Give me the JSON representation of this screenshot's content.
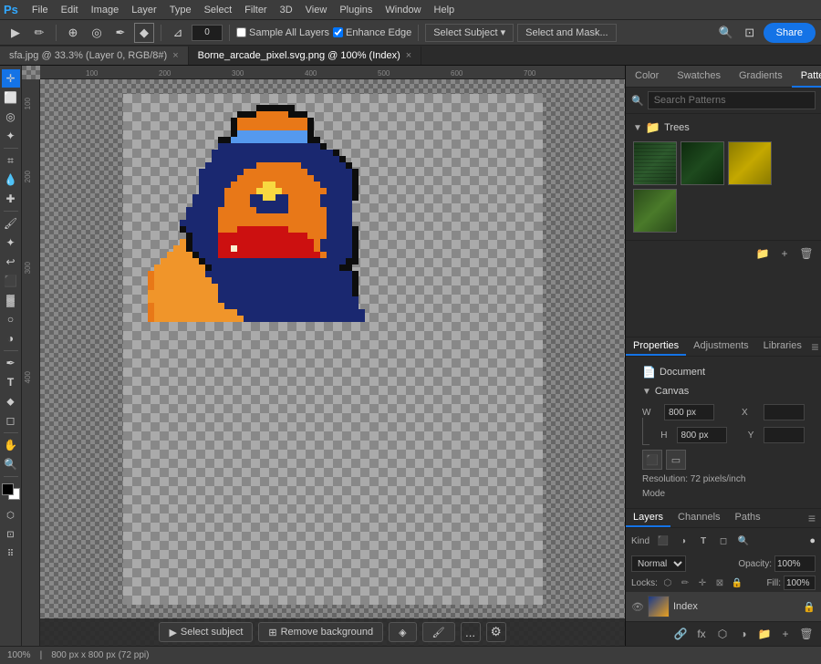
{
  "app": {
    "title": "Adobe Photoshop"
  },
  "menu": {
    "logo": "Ps",
    "items": [
      "File",
      "Edit",
      "Image",
      "Layer",
      "Type",
      "Select",
      "Filter",
      "3D",
      "View",
      "Plugins",
      "Window",
      "Help"
    ]
  },
  "toolbar": {
    "angle_value": "0",
    "sample_all_layers_label": "Sample All Layers",
    "enhance_edge_label": "Enhance Edge",
    "select_subject_label": "Select Subject",
    "select_mask_label": "Select and Mask...",
    "share_label": "Share"
  },
  "tabs": [
    {
      "label": "sfa.jpg @ 33.3% (Layer 0, RGB/8#)",
      "active": false
    },
    {
      "label": "Borne_arcade_pixel.svg.png @ 100% (Index)",
      "active": true
    }
  ],
  "canvas": {
    "zoom": "100%",
    "size": "800 px x 800 px (72 ppi)"
  },
  "patterns_panel": {
    "search_placeholder": "Search Patterns",
    "group_label": "Trees",
    "thumbnails": [
      {
        "id": 1,
        "class": "thumb-green-dark"
      },
      {
        "id": 2,
        "class": "thumb-green-medium"
      },
      {
        "id": 3,
        "class": "thumb-yellow-tree"
      },
      {
        "id": 4,
        "class": "thumb-green-grass"
      }
    ]
  },
  "top_panel_tabs": [
    {
      "label": "Color",
      "active": false
    },
    {
      "label": "Swatches",
      "active": false
    },
    {
      "label": "Gradients",
      "active": false
    },
    {
      "label": "Patterns",
      "active": true
    }
  ],
  "properties": {
    "title": "Properties",
    "section1": "Document",
    "section2_label": "Canvas",
    "w_label": "W",
    "h_label": "H",
    "x_label": "X",
    "y_label": "Y",
    "w_value": "800 px",
    "h_value": "800 px",
    "x_placeholder": "",
    "y_placeholder": "",
    "resolution_label": "Resolution: 72 pixels/inch",
    "mode_label": "Mode"
  },
  "sub_panels": {
    "layers_label": "Layers",
    "channels_label": "Channels",
    "paths_label": "Paths"
  },
  "layers": {
    "search_placeholder": "Kind",
    "blend_mode": "Normal",
    "opacity": "100%",
    "locks_label": "Locks:",
    "layer_name": "Index"
  },
  "status": {
    "zoom": "100%",
    "size_info": "800 px x 800 px (72 ppi)"
  },
  "bottom_tools": {
    "select_subject": "Select subject",
    "remove_bg": "Remove background",
    "more": "..."
  }
}
